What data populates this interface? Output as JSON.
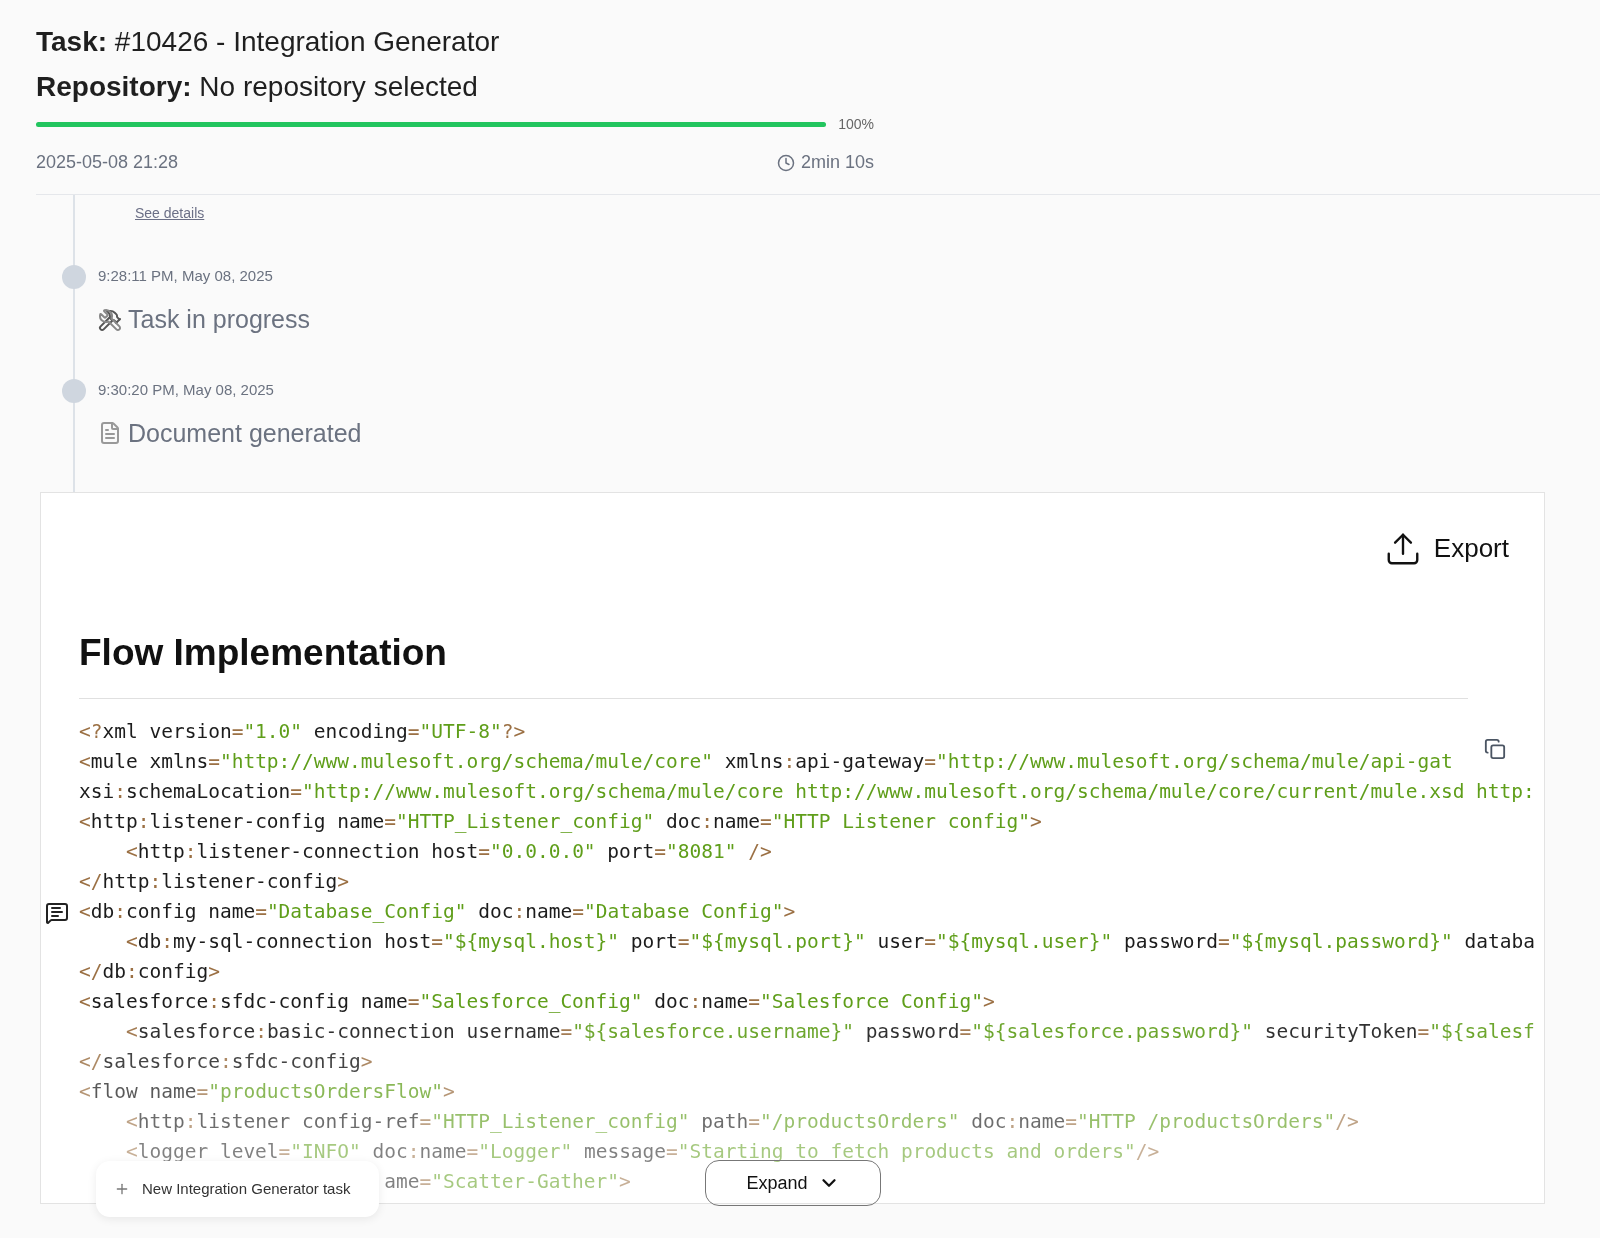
{
  "task": {
    "label": "Task:",
    "value": "#10426 - Integration Generator"
  },
  "repository": {
    "label": "Repository:",
    "value": "No repository selected"
  },
  "progress": {
    "level": 1,
    "reading": "100%"
  },
  "date": "2025-05-08 21:28",
  "duration": "2min 10s",
  "timeline": {
    "link": "See details",
    "events": [
      {
        "time": "9:28:11 PM, May 08, 2025",
        "kind": "tools",
        "title": "Task in progress"
      },
      {
        "time": "9:30:20 PM, May 08, 2025",
        "kind": "document",
        "title": "Document generated"
      }
    ]
  },
  "document": {
    "export": "Export",
    "heading": "Flow Implementation",
    "code_lines": [
      "<?xml version=\"1.0\" encoding=\"UTF-8\"?>",
      "<mule xmlns=\"http://www.mulesoft.org/schema/mule/core\" xmlns:api-gateway=\"http://www.mulesoft.org/schema/mule/api-gat",
      "xsi:schemaLocation=\"http://www.mulesoft.org/schema/mule/core http://www.mulesoft.org/schema/mule/core/current/mule.xsd http:",
      "<http:listener-config name=\"HTTP_Listener_config\" doc:name=\"HTTP Listener config\">",
      "    <http:listener-connection host=\"0.0.0.0\" port=\"8081\" />",
      "</http:listener-config>",
      "<db:config name=\"Database_Config\" doc:name=\"Database Config\">",
      "    <db:my-sql-connection host=\"${mysql.host}\" port=\"${mysql.port}\" user=\"${mysql.user}\" password=\"${mysql.password}\" databa",
      "</db:config>",
      "<salesforce:sfdc-config name=\"Salesforce_Config\" doc:name=\"Salesforce Config\">",
      "    <salesforce:basic-connection username=\"${salesforce.username}\" password=\"${salesforce.password}\" securityToken=\"${salesf",
      "</salesforce:sfdc-config>",
      "<flow name=\"productsOrdersFlow\">",
      "    <http:listener config-ref=\"HTTP_Listener_config\" path=\"/productsOrders\" doc:name=\"HTTP /productsOrders\"/>",
      "    <logger level=\"INFO\" doc:name=\"Logger\" message=\"Starting to fetch products and orders\"/>",
      "                          ame=\"Scatter-Gather\">"
    ],
    "expand": "Expand"
  },
  "new_task": "New Integration Generator task"
}
